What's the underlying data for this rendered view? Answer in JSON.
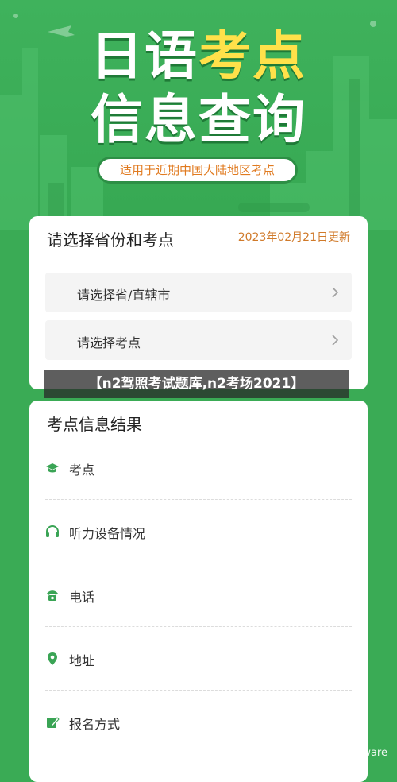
{
  "header": {
    "title_part1": "日语",
    "title_accent": "考点",
    "title_line2": "信息查询",
    "subtitle": "适用于近期中国大陆地区考点"
  },
  "select_card": {
    "title": "请选择省份和考点",
    "update_date": "2023年02月21日更新",
    "province_placeholder": "请选择省/直辖市",
    "site_placeholder": "请选择考点"
  },
  "overlay_caption": "【n2驾照考试题库,n2考场2021】",
  "result_card": {
    "title": "考点信息结果",
    "items": [
      {
        "label": "考点",
        "icon": "graduation-cap-icon"
      },
      {
        "label": "听力设备情况",
        "icon": "headphones-icon"
      },
      {
        "label": "电话",
        "icon": "telephone-icon"
      },
      {
        "label": "地址",
        "icon": "location-pin-icon"
      },
      {
        "label": "报名方式",
        "icon": "edit-icon"
      }
    ]
  },
  "credit": "知乎 @Alienware",
  "colors": {
    "background": "#3aab55",
    "accent_yellow": "#ffe14a",
    "date_orange": "#d07a2a",
    "icon_green": "#3aa455"
  }
}
